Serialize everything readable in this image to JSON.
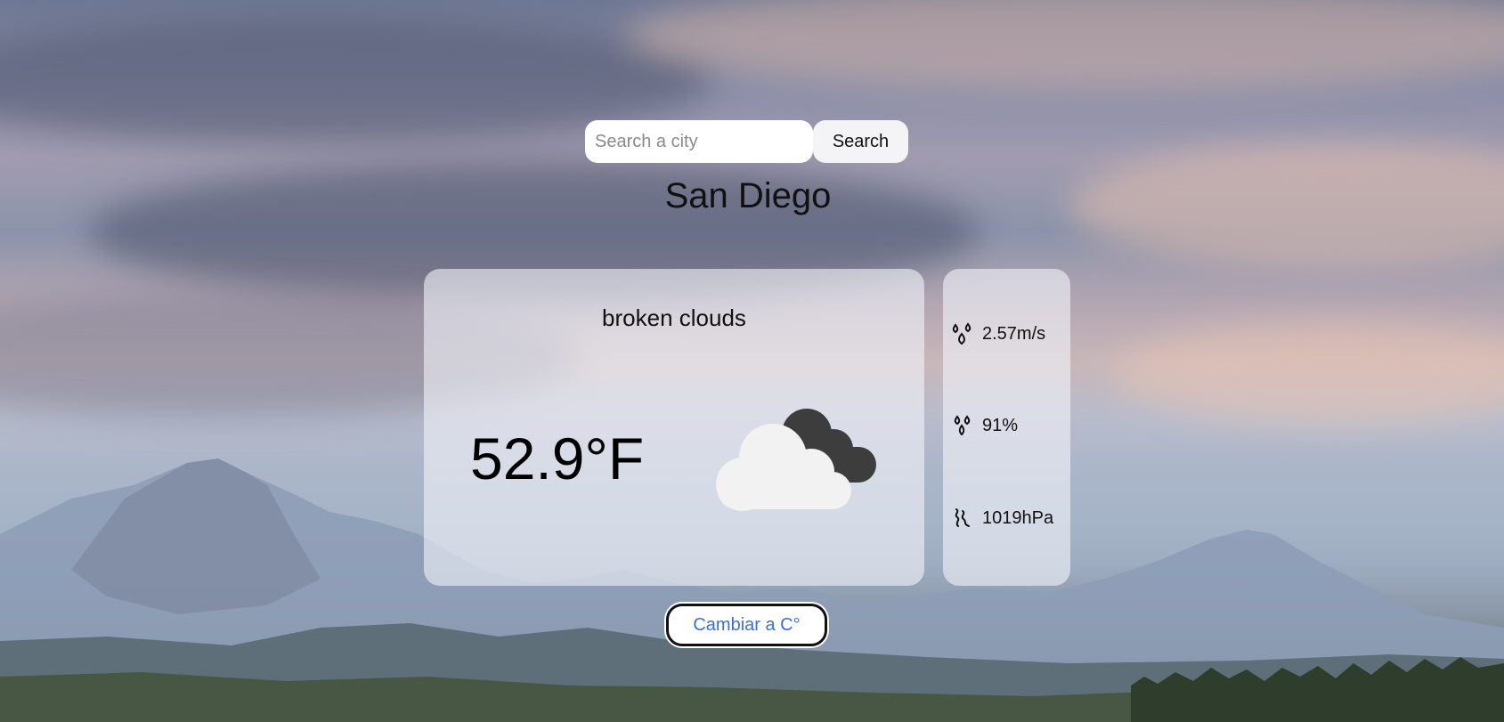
{
  "search": {
    "placeholder": "Search a city",
    "value": "",
    "button_label": "Search"
  },
  "city": "San Diego",
  "weather": {
    "description": "broken clouds",
    "temperature": "52.9°F",
    "icon": "broken-clouds-icon"
  },
  "stats": {
    "wind": {
      "icon": "wind-icon",
      "value": "2.57m/s"
    },
    "humidity": {
      "icon": "humidity-icon",
      "value": "91%"
    },
    "pressure": {
      "icon": "pressure-icon",
      "value": "1019hPa"
    }
  },
  "toggle": {
    "label": "Cambiar a C°"
  },
  "colors": {
    "toggle_text": "#3a6fd8",
    "card_background": "rgba(240,242,248,0.62)"
  }
}
